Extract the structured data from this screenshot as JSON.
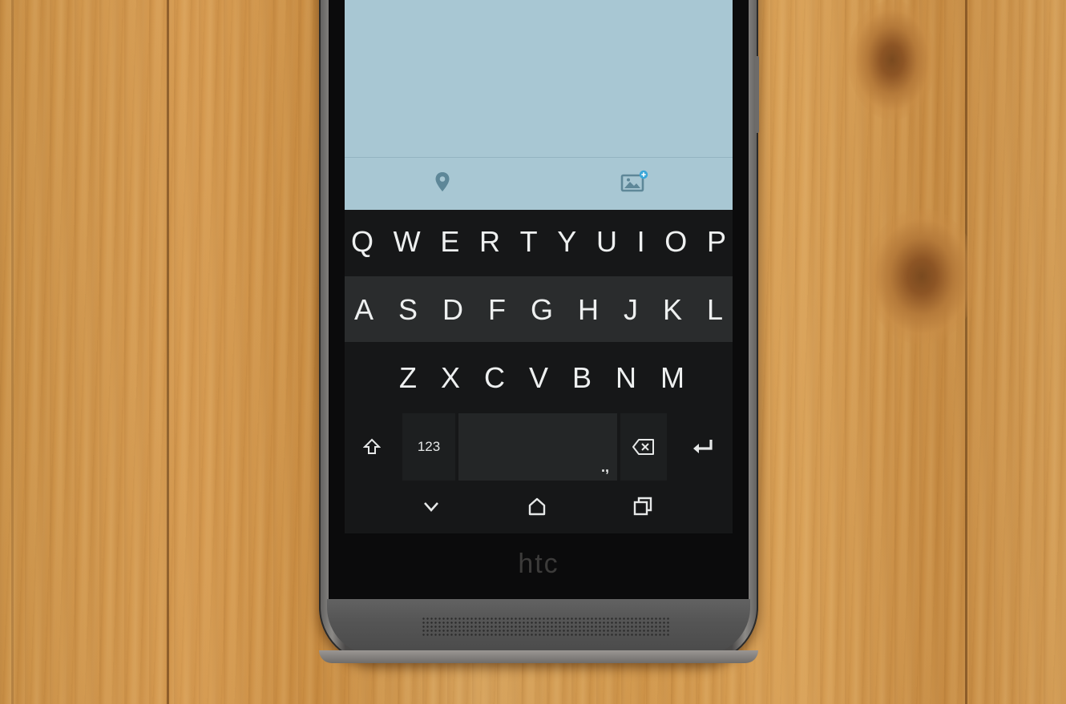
{
  "scene": {
    "surface": "wooden-table",
    "device_brand": "htc",
    "colors": {
      "wood": "#cf9448",
      "screen_compose": "#a8c7d3",
      "keyboard": "#161718",
      "key_text": "#eef0f0"
    }
  },
  "compose_toolbar": {
    "location_icon": "location-pin-icon",
    "photo_icon": "add-photo-icon"
  },
  "keyboard": {
    "row1": [
      "Q",
      "W",
      "E",
      "R",
      "T",
      "Y",
      "U",
      "I",
      "O",
      "P"
    ],
    "row2": [
      "A",
      "S",
      "D",
      "F",
      "G",
      "H",
      "J",
      "K",
      "L"
    ],
    "row3": [
      "Z",
      "X",
      "C",
      "V",
      "B",
      "N",
      "M"
    ],
    "shift_icon": "shift-arrow-icon",
    "numbers_label": "123",
    "space_hint": ".,",
    "backspace_icon": "backspace-icon",
    "enter_icon": "enter-icon"
  },
  "navbar": {
    "back_icon": "chevron-down-icon",
    "home_icon": "home-icon",
    "recents_icon": "recents-icon"
  }
}
